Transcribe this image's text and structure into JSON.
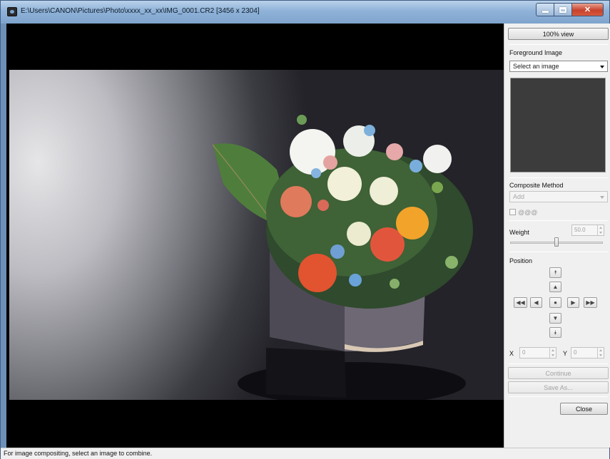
{
  "window": {
    "title": "E:\\Users\\CANON\\Pictures\\Photo\\xxxx_xx_xx\\IMG_0001.CR2 [3456 x 2304]",
    "accent": "#7fa4cd"
  },
  "panel": {
    "view_100_label": "100% view",
    "foreground": {
      "label": "Foreground Image",
      "select_value": "Select an image"
    },
    "composite": {
      "label": "Composite Method",
      "select_value": "Add",
      "checkbox_label": "@@@"
    },
    "weight": {
      "label": "Weight",
      "value": "50.0",
      "slider_fraction": 0.5
    },
    "position": {
      "label": "Position",
      "x_label": "X",
      "x_value": "0",
      "y_label": "Y",
      "y_value": "0"
    },
    "continue_label": "Continue",
    "save_as_label": "Save As...",
    "close_label": "Close"
  },
  "statusbar": {
    "text": "For image compositing, select an image to combine."
  },
  "icons": {
    "nav_top": "double-up-icon",
    "nav_up": "up-icon",
    "nav_far_left": "double-left-icon",
    "nav_left": "left-icon",
    "nav_center": "center-dot-icon",
    "nav_right": "right-icon",
    "nav_far_right": "double-right-icon",
    "nav_down": "down-icon",
    "nav_bottom": "double-down-icon"
  }
}
